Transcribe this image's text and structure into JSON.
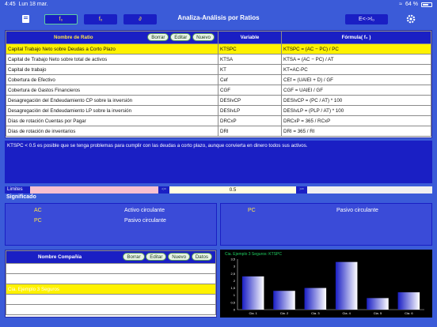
{
  "status": {
    "time": "4:45",
    "date": "Lun 18 mar.",
    "battery": "64 %"
  },
  "toolbar": {
    "book_icon": "book-icon",
    "btn_f0": "f₀",
    "btn_fx": "fₓ",
    "btn_d": "∂",
    "title": "Analiza-Análisis por Ratios",
    "btn_e": "E<->I₀",
    "gear_icon": "gear-icon"
  },
  "ratios": {
    "header_name": "Nombre de Ratio",
    "header_variable": "Variable",
    "header_formula": "Fórmula( f₀ )",
    "actions": [
      "Borrar",
      "Editar",
      "Nuevo"
    ],
    "rows": [
      {
        "name": "Capital Trabajo Neto sobre Deudas a Corto Plazo",
        "variable": "KTSPC",
        "formula": "KTSPC = (AC − PC) / PC"
      },
      {
        "name": "Capital de Trabajo Neto sobre total de activos",
        "variable": "KTSA",
        "formula": "KTSA = (AC − PC) / AT"
      },
      {
        "name": "Capital de trabajo",
        "variable": "KT",
        "formula": "KT=AC-PC"
      },
      {
        "name": "Cobertura de Efectivo",
        "variable": "Cef",
        "formula": "CEf = (UAIEI + D) / GF"
      },
      {
        "name": "Cobertura de Gastos Financieros",
        "variable": "CGF",
        "formula": "CGF = UAIEI / GF"
      },
      {
        "name": "Desagregación del Endeudamiento CP sobre la inversión",
        "variable": "DESIvCP",
        "formula": "DESIvCP = (PC / AT) * 100"
      },
      {
        "name": "Desagregación del Endeudamiento LP sobre la inversión",
        "variable": "DESIvLP",
        "formula": "DESIvLP = (PLP / AT) * 100"
      },
      {
        "name": "Días de rotación Cuentas por Pagar",
        "variable": "DRCxP",
        "formula": "DRCxP = 365 / RCxP"
      },
      {
        "name": "Días de rotación de inventarios",
        "variable": "DRI",
        "formula": "DRI = 365 / RI"
      }
    ]
  },
  "description": "KTSPC < 0.5 es posible que se tenga problemas para cumplir con las deudas a corto plazo, aunque convierta en dinero todos sus activos.",
  "limites": {
    "label": "Limites",
    "left_marker": "<=",
    "value": "0.5",
    "right_marker": ">="
  },
  "significado": {
    "label": "Significado",
    "left": [
      {
        "var": "AC",
        "desc": "Activo circulante"
      },
      {
        "var": "PC",
        "desc": "Pasivo circulante"
      }
    ],
    "right": [
      {
        "var": "PC",
        "desc": "Pasivo circulante"
      }
    ]
  },
  "companies": {
    "header": "Nombre Compañía",
    "actions": [
      "Borrar",
      "Editar",
      "Nuevo",
      "Datos"
    ],
    "rows": [
      "Cia. Ejemplo 1",
      "Cia. Ejemplo 2",
      "Cia. Ejemplo 3 Seguros"
    ]
  },
  "chart_data": {
    "type": "bar",
    "title": "Cia. Ejemplo 3 Seguros: KTSPC",
    "categories": [
      "Cia. 1",
      "Cia. 2",
      "Cia. 3",
      "Cia. 4",
      "Cia. 5",
      "Cia. 6"
    ],
    "values": [
      2.3,
      1.3,
      1.5,
      3.3,
      0.8,
      1.2
    ],
    "yticks": [
      "3,5",
      "3",
      "2,5",
      "2",
      "1,5",
      "1",
      "0,5",
      "0"
    ],
    "ylim": [
      0,
      3.5
    ],
    "colors": {
      "bar_start": "#1a1fc4",
      "bar_end": "#ffffff",
      "title": "#1fd060"
    }
  }
}
